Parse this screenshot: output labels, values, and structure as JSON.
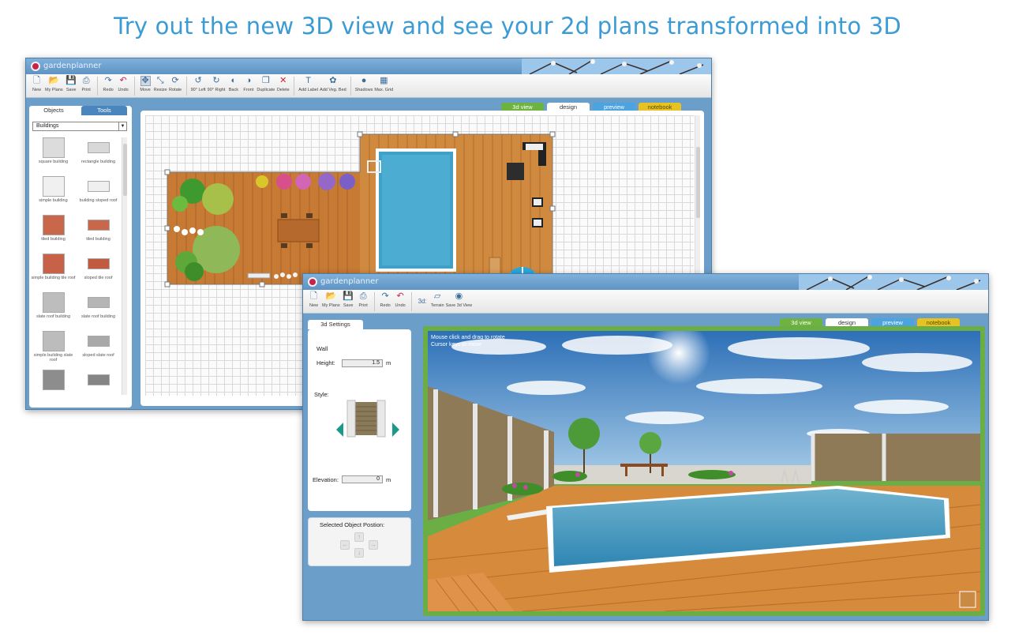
{
  "headline": "Try out the new 3D view and see your 2d plans transformed into 3D",
  "window_design": {
    "app_name": "gardenplanner",
    "toolbar": [
      {
        "label": "New",
        "icon": "new-icon"
      },
      {
        "label": "My Plans",
        "icon": "folder-icon"
      },
      {
        "label": "Save",
        "icon": "save-icon"
      },
      {
        "label": "Print",
        "icon": "print-icon"
      },
      {
        "label": "Redo",
        "icon": "redo-icon"
      },
      {
        "label": "Undo",
        "icon": "undo-icon"
      },
      {
        "label": "Move",
        "icon": "move-icon"
      },
      {
        "label": "Resize",
        "icon": "resize-icon"
      },
      {
        "label": "Rotate",
        "icon": "rotate-icon"
      },
      {
        "label": "90° Left",
        "icon": "rotate-left-icon"
      },
      {
        "label": "90° Right",
        "icon": "rotate-right-icon"
      },
      {
        "label": "Back",
        "icon": "send-back-icon"
      },
      {
        "label": "Front",
        "icon": "bring-front-icon"
      },
      {
        "label": "Duplicate",
        "icon": "duplicate-icon"
      },
      {
        "label": "Delete",
        "icon": "delete-icon"
      },
      {
        "label": "Add Label",
        "icon": "label-icon"
      },
      {
        "label": "Add Veg. Bed",
        "icon": "veg-bed-icon"
      },
      {
        "label": "Shadows",
        "icon": "shadows-icon"
      },
      {
        "label": "Max. Grid",
        "icon": "grid-icon"
      }
    ],
    "view_tabs": [
      "3d view",
      "design",
      "preview",
      "notebook"
    ],
    "panel_tabs": [
      "Objects",
      "Tools"
    ],
    "category_select": "Buildings",
    "objects": [
      "square building",
      "rectangle building",
      "simple building",
      "building sloped roof",
      "tiled building",
      "tiled building",
      "simple building tile roof",
      "sloped tile roof",
      "slate roof building",
      "slate roof building",
      "simple building slate roof",
      "sloped slate roof",
      "",
      ""
    ]
  },
  "window_3d": {
    "app_name": "gardenplanner",
    "toolbar": [
      {
        "label": "New",
        "icon": "new-icon"
      },
      {
        "label": "My Plans",
        "icon": "folder-icon"
      },
      {
        "label": "Save",
        "icon": "save-icon"
      },
      {
        "label": "Print",
        "icon": "print-icon"
      },
      {
        "label": "Redo",
        "icon": "redo-icon"
      },
      {
        "label": "Undo",
        "icon": "undo-icon"
      },
      {
        "label": "Terrain",
        "icon": "terrain-icon"
      },
      {
        "label": "Save 3d View",
        "icon": "camera-icon"
      }
    ],
    "mode_label": "3d:",
    "view_tabs": [
      "3d view",
      "design",
      "preview",
      "notebook"
    ],
    "settings_tab": "3d Settings",
    "section_title": "Wall",
    "height_label": "Height:",
    "height_value": "1.5",
    "height_unit": "m",
    "style_label": "Style:",
    "elevation_label": "Elevation:",
    "elevation_value": "0",
    "elevation_unit": "m",
    "position_title": "Selected Object Postion:",
    "hint_line1": "Mouse click and drag to rotate",
    "hint_line2": "Cursor keys to move"
  },
  "colors": {
    "headline": "#3a9bd5",
    "window_frame": "#6b9ec9",
    "tab_3d": "#6eb33f",
    "tab_preview": "#4ba3e0",
    "tab_notebook": "#e6c323",
    "deck": "#d68a3c",
    "pool": "#3fa0c8",
    "view_frame": "#6aae45"
  }
}
